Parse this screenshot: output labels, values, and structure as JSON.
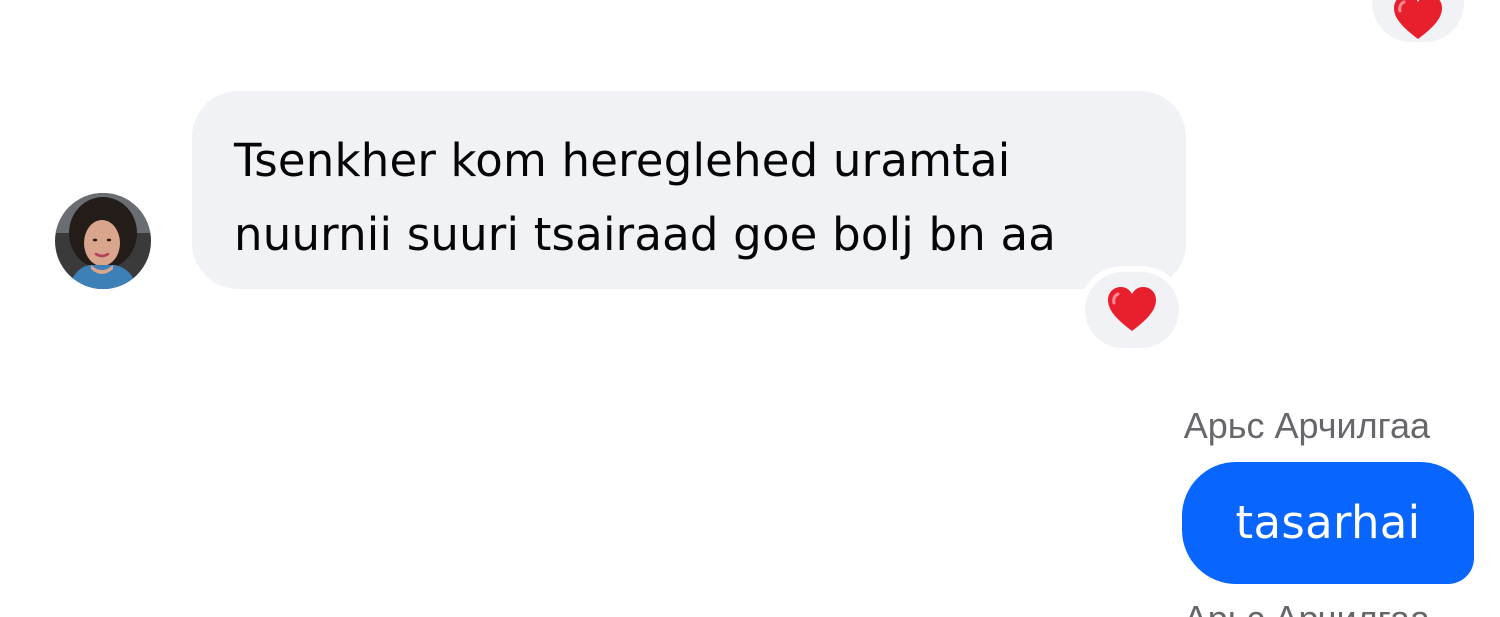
{
  "thread": {
    "previous_reaction": {
      "emoji_icon": "red-heart-icon",
      "color": "#e8202e"
    },
    "incoming_message": {
      "avatar_icon": "contact-avatar",
      "lines": [
        "Tsenkher kom hereglehed uramtai",
        "nuurnii suuri tsairaad goe bolj bn aa"
      ],
      "bubble_color": "#f0f2f5",
      "reaction": {
        "emoji_icon": "red-heart-icon",
        "color": "#e8202e"
      }
    },
    "outgoing_message": {
      "sender_name": "Арьс Арчилгаа",
      "text": "tasarhai",
      "bubble_color": "#0866ff"
    },
    "next_message": {
      "sender_name": "Арьс Арчилгаа"
    }
  }
}
